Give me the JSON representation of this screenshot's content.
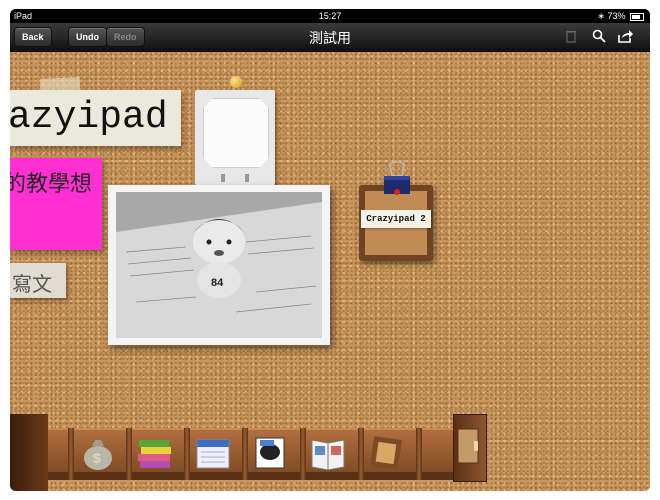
{
  "status_bar": {
    "device": "iPad",
    "time": "15:27",
    "battery": "73%"
  },
  "nav": {
    "back_label": "Back",
    "undo_label": "Undo",
    "redo_label": "Redo",
    "title": "測試用",
    "icons": [
      "trash-icon",
      "search-icon",
      "share-icon"
    ]
  },
  "board": {
    "title_note": "azyipad",
    "pink_note": "的教學想",
    "write_note": "寫文",
    "clip_label": "Crazyipad 2",
    "photo_badge": "84"
  },
  "shelf": {
    "items": [
      "money-bag-icon",
      "books-icon",
      "calendar-icon",
      "comic-icon",
      "book-icon",
      "frame-icon"
    ]
  }
}
